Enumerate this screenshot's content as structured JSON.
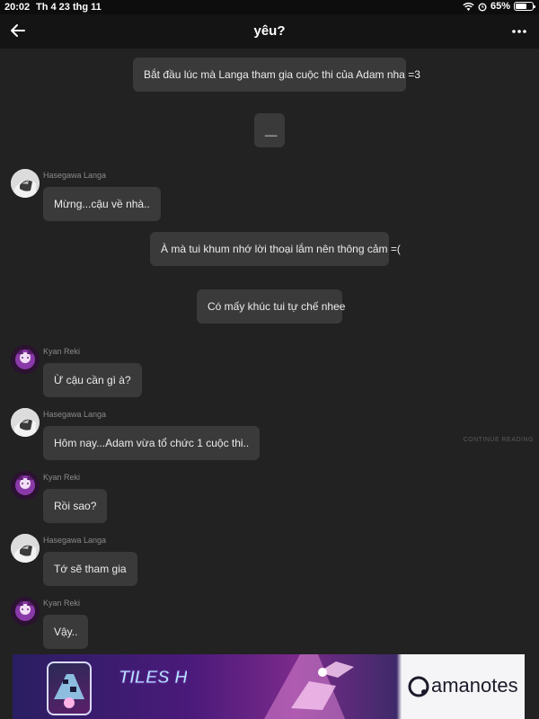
{
  "status_bar": {
    "time": "20:02",
    "date": "Th 4 23 thg 11",
    "battery": "65%",
    "battery_level": 0.65
  },
  "header": {
    "title": "yêu?"
  },
  "messages": [
    {
      "type": "narration",
      "text": "Bắt đầu lúc mà Langa tham gia cuộc thi của Adam nha =3"
    },
    {
      "type": "narration",
      "text": "__"
    },
    {
      "type": "chat",
      "speaker": "Hasegawa Langa",
      "text": "Mừng...cậu về nhà.."
    },
    {
      "type": "narration",
      "text": "À mà tui khum nhớ lời thoại lắm nên thông cảm =("
    },
    {
      "type": "narration",
      "text": "Có mấy khúc tui tự chế nhee"
    },
    {
      "type": "chat",
      "speaker": "Kyan Reki",
      "text": "Ừ cậu cần gì à?"
    },
    {
      "type": "chat",
      "speaker": "Hasegawa Langa",
      "text": "Hôm nay...Adam vừa tổ chức 1 cuộc thi.."
    },
    {
      "type": "chat",
      "speaker": "Kyan Reki",
      "text": "Rồi sao?"
    },
    {
      "type": "chat",
      "speaker": "Hasegawa Langa",
      "text": "Tớ sẽ tham gia"
    },
    {
      "type": "chat",
      "speaker": "Kyan Reki",
      "text": "Vậy.."
    }
  ],
  "watermark": "CONTINUE READING",
  "ad": {
    "game_title": "TILES HOP",
    "brand": "amanotes"
  },
  "icons": {
    "back": "arrow-left-icon",
    "more": "more-horizontal-icon",
    "wifi": "wifi-icon",
    "alarm": "alarm-icon",
    "battery": "battery-icon"
  }
}
